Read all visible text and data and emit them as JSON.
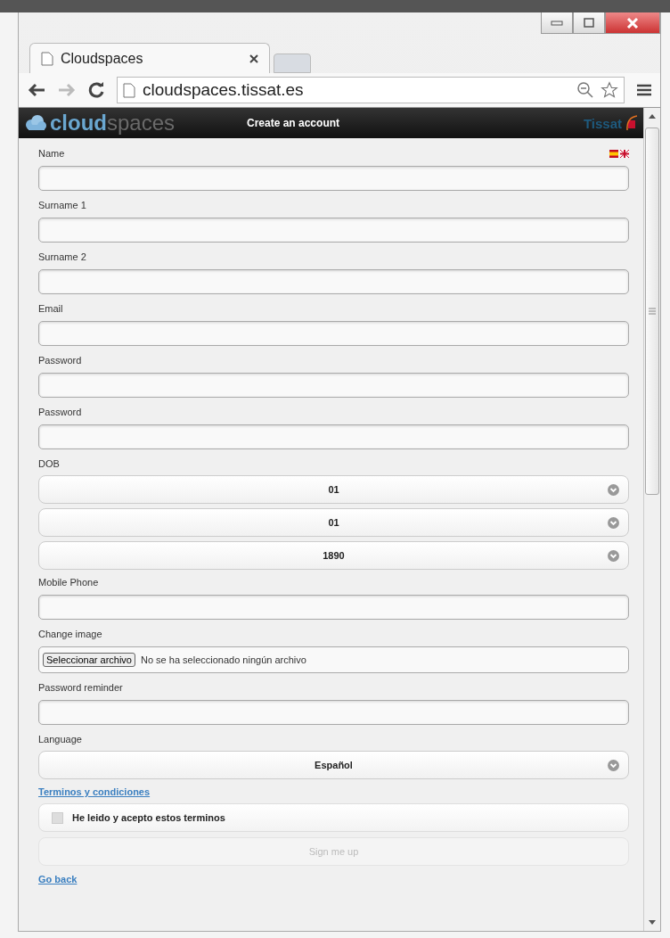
{
  "browser": {
    "tab_title": "Cloudspaces",
    "url": "cloudspaces.tissat.es"
  },
  "header": {
    "logo_bold": "cloud",
    "logo_light": "spaces",
    "title": "Create an account",
    "brand": "Tissat"
  },
  "form": [
    {
      "kind": "text",
      "label": "Name",
      "flags": true
    },
    {
      "kind": "text",
      "label": "Surname 1"
    },
    {
      "kind": "text",
      "label": "Surname 2"
    },
    {
      "kind": "text",
      "label": "Email"
    },
    {
      "kind": "text",
      "label": "Password"
    },
    {
      "kind": "text",
      "label": "Password"
    },
    {
      "kind": "selects",
      "label": "DOB",
      "values": [
        "01",
        "01",
        "1890"
      ]
    },
    {
      "kind": "text",
      "label": "Mobile Phone"
    },
    {
      "kind": "file",
      "label": "Change image",
      "button": "Seleccionar archivo",
      "status": "No se ha seleccionado ningún archivo"
    },
    {
      "kind": "text",
      "label": "Password reminder"
    },
    {
      "kind": "selects",
      "label": "Language",
      "values": [
        "Español"
      ]
    },
    {
      "kind": "link",
      "label": "Terminos y condiciones"
    },
    {
      "kind": "checkbox",
      "label": "He leido y acepto estos terminos",
      "checked": false
    },
    {
      "kind": "button",
      "label": "Sign me up",
      "disabled": true
    },
    {
      "kind": "link",
      "label": "Go back"
    }
  ]
}
